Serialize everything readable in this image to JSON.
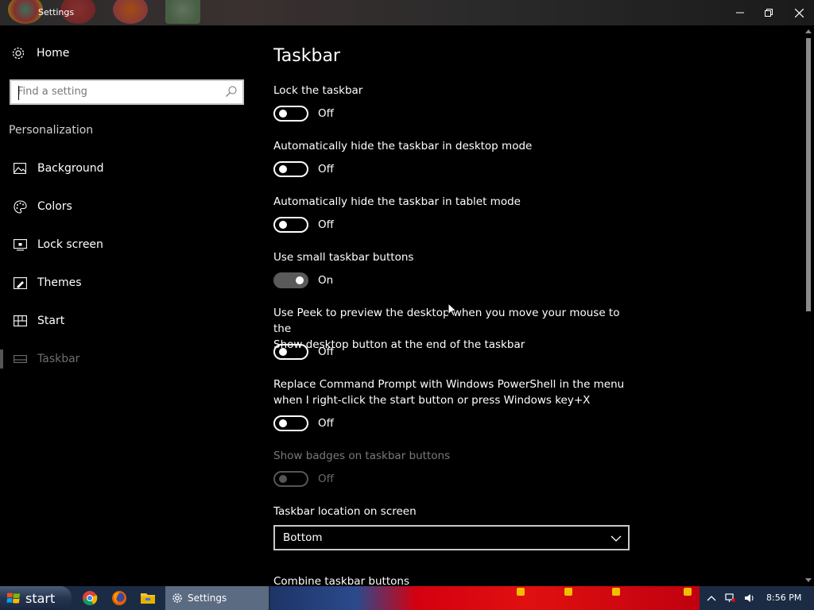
{
  "window": {
    "title": "Settings",
    "controls": {
      "minimize": "—",
      "restore": "❐",
      "close": "✕"
    }
  },
  "sidebar": {
    "home_label": "Home",
    "search_placeholder": "Find a setting",
    "section_title": "Personalization",
    "items": [
      {
        "label": "Background",
        "icon": "picture-icon"
      },
      {
        "label": "Colors",
        "icon": "palette-icon"
      },
      {
        "label": "Lock screen",
        "icon": "lock-screen-icon"
      },
      {
        "label": "Themes",
        "icon": "themes-icon"
      },
      {
        "label": "Start",
        "icon": "start-tiles-icon"
      },
      {
        "label": "Taskbar",
        "icon": "taskbar-icon",
        "selected": true
      }
    ]
  },
  "main": {
    "title": "Taskbar",
    "settings": [
      {
        "label": "Lock the taskbar",
        "state": "Off"
      },
      {
        "label": "Automatically hide the taskbar in desktop mode",
        "state": "Off"
      },
      {
        "label": "Automatically hide the taskbar in tablet mode",
        "state": "Off"
      },
      {
        "label": "Use small taskbar buttons",
        "state": "On"
      },
      {
        "label_line1": "Use Peek to preview the desktop when you move your mouse to the",
        "label_line2": "Show desktop button at the end of the taskbar",
        "state": "Off"
      },
      {
        "label_line1": "Replace Command Prompt with Windows PowerShell in the menu",
        "label_line2": "when I right-click the start button or press Windows key+X",
        "state": "Off"
      },
      {
        "label": "Show badges on taskbar buttons",
        "state": "Off",
        "disabled": true
      }
    ],
    "location_label": "Taskbar location on screen",
    "location_value": "Bottom",
    "combine_label": "Combine taskbar buttons"
  },
  "taskbar": {
    "start_label": "start",
    "active_app_label": "Settings",
    "clock": "8:56 PM"
  },
  "colors": {
    "background": "#000000",
    "toggle_on": "#5a5a5a",
    "taskbar": "#1b2b44"
  }
}
